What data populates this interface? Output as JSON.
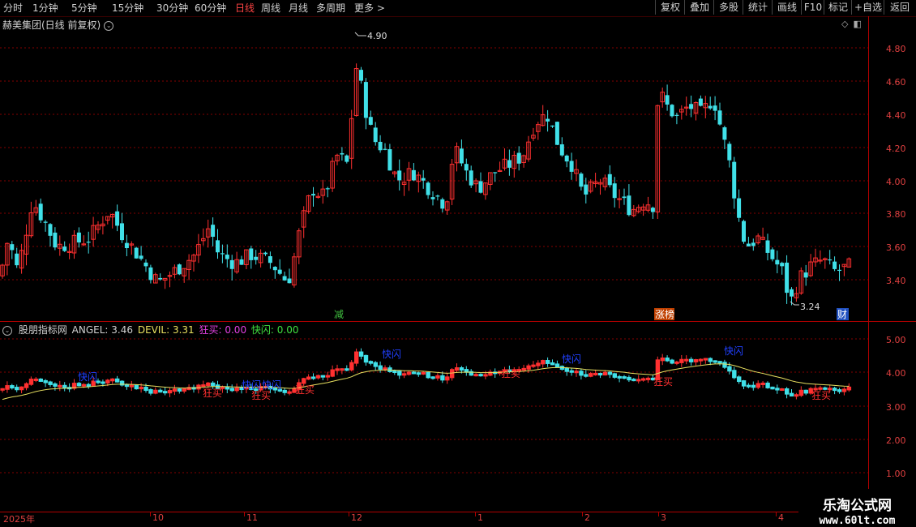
{
  "toolbar": {
    "periods": [
      "分时",
      "1分钟",
      "5分钟",
      "15分钟",
      "30分钟",
      "60分钟",
      "日线",
      "周线",
      "月线",
      "多周期",
      "更多 >"
    ],
    "active_period": "日线",
    "tools": [
      "复权",
      "叠加",
      "多股",
      "统计",
      "画线",
      "F10",
      "标记",
      "+自选",
      "返回"
    ]
  },
  "stock_title": "赫美集团(日线 前复权)",
  "main_chart": {
    "y_labels": [
      "4.80",
      "4.60",
      "4.40",
      "4.20",
      "4.00",
      "3.80",
      "3.60",
      "3.40"
    ],
    "high_label": "4.90",
    "low_label": "3.24",
    "markers": [
      {
        "text": "减",
        "color": "#40c040"
      },
      {
        "text": "涨榜",
        "color": "#ffffff",
        "bg": "#c04000"
      },
      {
        "text": "财",
        "color": "#ffffff",
        "bg": "#2050c0"
      }
    ]
  },
  "indicator": {
    "name": "股朋指标网",
    "angel_label": "ANGEL: 3.46",
    "devil_label": "DEVIL: 3.31",
    "kuangmai_label": "狂买: 0.00",
    "kuaishan_label": "快闪: 0.00",
    "y_labels": [
      "5.00",
      "4.00",
      "3.00",
      "2.00",
      "1.00"
    ],
    "signal_buy": "狂买",
    "signal_flash": "快闪"
  },
  "x_axis": {
    "labels": [
      "2025年",
      "10",
      "11",
      "12",
      "1",
      "2",
      "3",
      "4"
    ]
  },
  "watermark": {
    "line1": "乐淘公式网",
    "line2": "www.60lt.com"
  },
  "colors": {
    "up": "#ff3030",
    "down": "#40e0e8",
    "ma": "#e8e060",
    "axis": "#b00000",
    "grid": "#b00000"
  }
}
